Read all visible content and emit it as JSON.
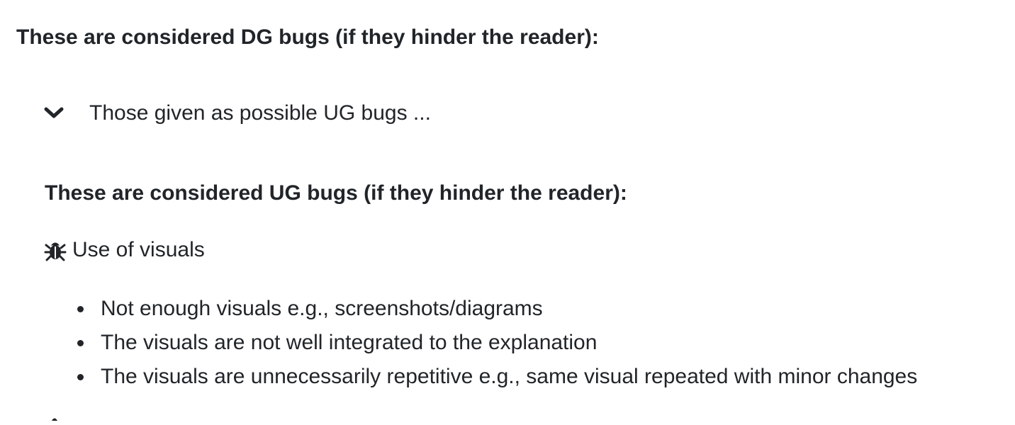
{
  "dg_heading": "These are considered DG bugs (if they hinder the reader):",
  "collapsible": {
    "label": "Those given as possible UG bugs ...",
    "icon": "chevron-down-icon",
    "expanded": false
  },
  "ug_heading": "These are considered UG bugs (if they hinder the reader):",
  "bug_category": {
    "icon": "bug-icon",
    "title": "Use of visuals",
    "items": [
      "Not enough visuals e.g., screenshots/diagrams",
      "The visuals are not well integrated to the explanation",
      "The visuals are unnecessarily repetitive e.g., same visual repeated with minor changes"
    ]
  },
  "colors": {
    "text": "#212529"
  }
}
